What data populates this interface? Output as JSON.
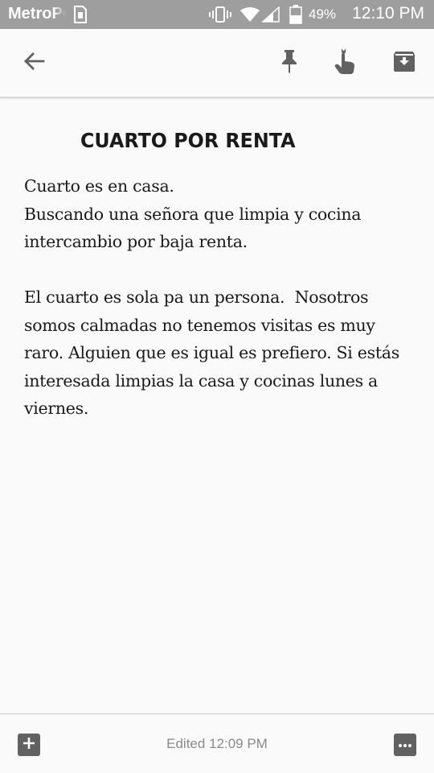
{
  "status_bar": {
    "carrier": "MetroPCS",
    "battery_percent": "49%",
    "time": "12:10 PM",
    "battery_level": 0.49,
    "icons": [
      "sim-icon",
      "vibrate-icon",
      "wifi-icon",
      "signal-icon",
      "battery-icon"
    ]
  },
  "toolbar": {
    "icons": [
      "back-arrow-icon",
      "pin-icon",
      "reminder-icon",
      "archive-icon"
    ]
  },
  "note": {
    "title": "CUARTO POR RENTA",
    "body": "Cuarto es en casa.\nBuscando una señora que limpia y cocina intercambio por baja renta.\n\nEl cuarto es sola pa un persona.  Nosotros somos calmadas no tenemos visitas es muy raro. Alguien que es igual es prefiero. Si estás interesada limpias la casa y cocinas lunes a viernes."
  },
  "bottom_bar": {
    "edited_label": "Edited 12:09 PM",
    "icons": [
      "add-icon",
      "more-icon"
    ]
  },
  "colors": {
    "status_bar": "#9e9e9e",
    "icon": "#616161",
    "background": "#fafafa",
    "text": "#1a1a1a"
  }
}
